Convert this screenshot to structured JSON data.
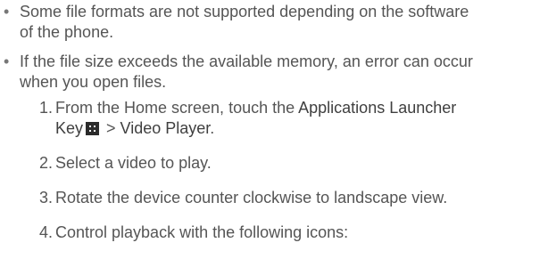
{
  "bullets": [
    {
      "line1": "Some file formats are not supported depending on the software",
      "line2": "of the phone."
    },
    {
      "line1": "If the file size exceeds the available memory, an error can occur",
      "line2": "when you open files."
    }
  ],
  "steps": [
    {
      "number": "1.",
      "pre": "From the Home screen, touch the ",
      "bold1": "Applications Launcher",
      "bold1b": "Key",
      "icon": "apps-grid-icon",
      "sep": " > ",
      "bold2": "Video Player",
      "post": "."
    },
    {
      "number": "2.",
      "text": "Select a video to play."
    },
    {
      "number": "3.",
      "text": "Rotate the device counter clockwise to landscape view."
    },
    {
      "number": "4.",
      "text": "Control playback with the following icons:"
    }
  ]
}
